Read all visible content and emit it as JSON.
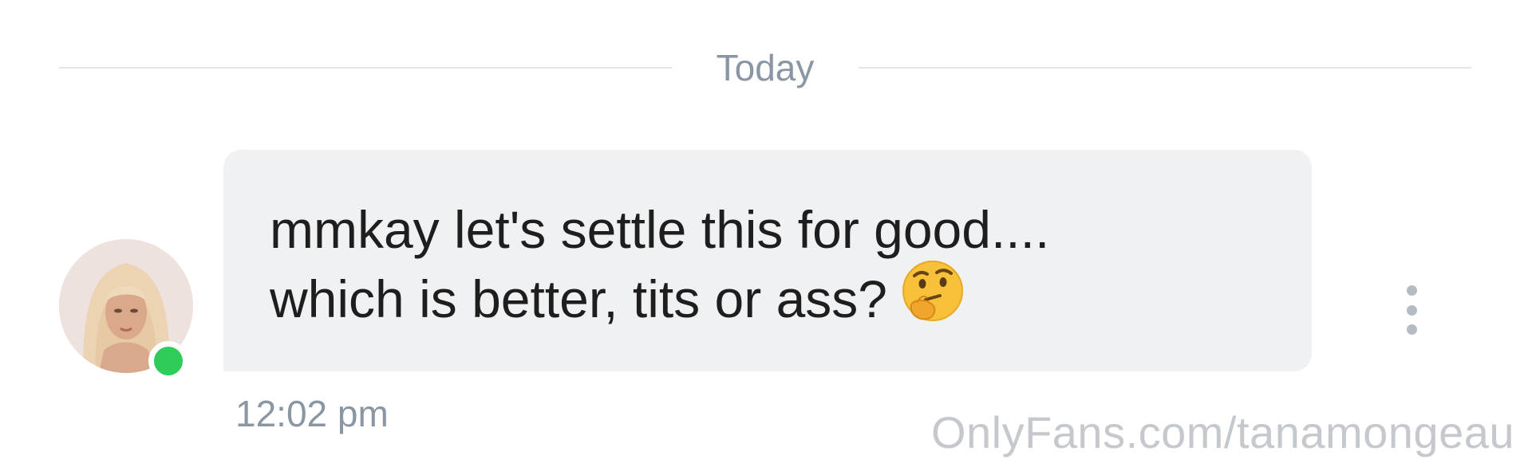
{
  "date_divider": {
    "label": "Today"
  },
  "message": {
    "text_line_1": "mmkay let's settle this for good....",
    "text_line_2": "which is better, tits or ass?",
    "emoji": "thinking-face-icon",
    "timestamp": "12:02 pm",
    "sender_online": true
  },
  "watermark": {
    "text": "OnlyFans.com/tanamongeau"
  },
  "colors": {
    "bubble_bg": "#f0f1f3",
    "online_green": "#2fcc59",
    "muted_text": "#8a96a3",
    "divider": "#e3e5e8"
  }
}
